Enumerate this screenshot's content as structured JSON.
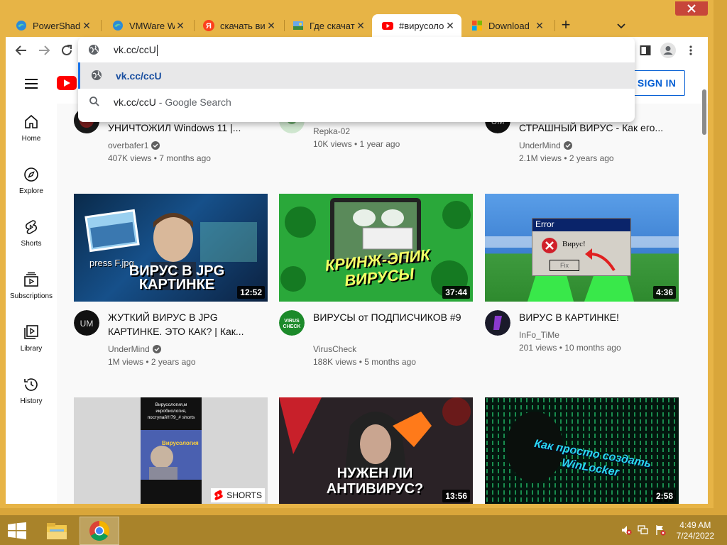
{
  "browser": {
    "tabs": [
      {
        "title": "PowerShad",
        "icon": "edge-icon"
      },
      {
        "title": "VMWare W",
        "icon": "edge-icon"
      },
      {
        "title": "скачать ви",
        "icon": "yandex-icon"
      },
      {
        "title": "Где скачать",
        "icon": "image-icon"
      },
      {
        "title": "#вирусоло",
        "icon": "youtube-icon",
        "active": true
      },
      {
        "title": "Download",
        "icon": "microsoft-icon"
      }
    ],
    "omnibox": {
      "value": "vk.cc/ccU",
      "suggestions": [
        {
          "text": "vk.cc/ccU",
          "suffix": "",
          "icon": "globe-icon"
        },
        {
          "text": "vk.cc/ccU",
          "suffix": " - Google Search",
          "icon": "search-icon"
        }
      ]
    }
  },
  "youtube": {
    "sign_in": "SIGN IN",
    "sidebar": [
      {
        "label": "Home",
        "icon": "home-icon"
      },
      {
        "label": "Explore",
        "icon": "compass-icon"
      },
      {
        "label": "Shorts",
        "icon": "shorts-icon"
      },
      {
        "label": "Subscriptions",
        "icon": "subscriptions-icon"
      },
      {
        "label": "Library",
        "icon": "library-icon"
      },
      {
        "label": "History",
        "icon": "history-icon"
      }
    ],
    "row0": [
      {
        "title": "УНИЧТОЖИЛ Windows 11 |...",
        "channel": "overbafer1",
        "verified": true,
        "meta": "407K views • 7 months ago"
      },
      {
        "title": "",
        "channel": "Repka-02",
        "verified": false,
        "meta": "10K views • 1 year ago"
      },
      {
        "title": "СТРАШНЫЙ ВИРУС - Как его...",
        "channel": "UnderMind",
        "verified": true,
        "meta": "2.1M views • 2 years ago"
      }
    ],
    "row1": [
      {
        "title": "ЖУТКИЙ ВИРУС В JPG КАРТИНКЕ. ЭТО КАК? | Как...",
        "channel": "UnderMind",
        "verified": true,
        "meta": "1M views • 2 years ago",
        "duration": "12:52",
        "thumb_text": "ВИРУС В JPG КАРТИНКЕ",
        "thumb_sub": "press F.jpg"
      },
      {
        "title": "ВИРУСЫ от ПОДПИСЧИКОВ #9",
        "channel": "VirusCheck",
        "verified": false,
        "meta": "188K views • 5 months ago",
        "duration": "37:44",
        "thumb_text": "КРИНЖ-ЭПИК ВИРУСЫ"
      },
      {
        "title": "ВИРУС В КАРТИНКЕ!",
        "channel": "InFo_TiMe",
        "verified": false,
        "meta": "201 views • 10 months ago",
        "duration": "4:36",
        "thumb_err_title": "Error",
        "thumb_err_msg": "Вирус!",
        "thumb_err_btn": "Fix"
      }
    ],
    "row2": [
      {
        "badge": "SHORTS",
        "thumb_text": "Вирусология,м икробиология, поступай!!!79_# shorts",
        "thumb_sub": "Вирусология"
      },
      {
        "duration": "13:56",
        "thumb_text": "НУЖЕН ЛИ АНТИВИРУС?"
      },
      {
        "duration": "2:58",
        "thumb_text": "Как просто создать WinLocker"
      }
    ]
  },
  "taskbar": {
    "time": "4:49 AM",
    "date": "7/24/2022"
  },
  "colors": {
    "window_frame": "#e7b446",
    "taskbar": "#a9832a",
    "yt_red": "#ff0000",
    "link_blue": "#065fd4"
  }
}
